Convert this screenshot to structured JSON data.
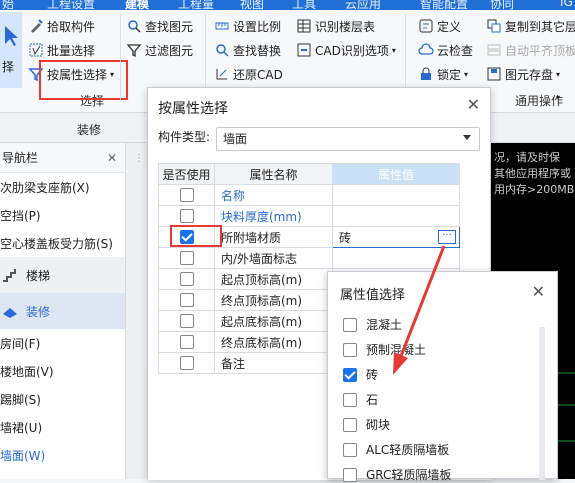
{
  "ribbon": {
    "tabs": [
      "始",
      "工程设置",
      "建模",
      "工程量",
      "视图",
      "工具",
      "云应用",
      "智能配置",
      "协同",
      "IG"
    ],
    "group1": {
      "big_label": "择",
      "pick": "拾取构件",
      "batch": "批量选择",
      "by_attr": "按属性选择",
      "group": "选择"
    },
    "group2": {
      "find": "查找图元",
      "filter": "过滤图元"
    },
    "group3": {
      "scale": "设置比例",
      "find_replace": "查找替换",
      "restore": "还原CAD"
    },
    "group4": {
      "layer": "识别楼层表",
      "cad_opts": "CAD识别选项"
    },
    "group5": {
      "define": "定义",
      "cloud": "云检查",
      "lock": "锁定",
      "copy_floor": "复制到其它层",
      "auto_align": "自动平齐顶板",
      "store": "图元存盘",
      "group": "通用操作"
    },
    "subbar": "装修"
  },
  "nav": {
    "title": "导航栏",
    "items": [
      "次肋梁支座筋(X)",
      "空挡(P)",
      "空心楼盖板受力筋(S)",
      "楼梯",
      "装修",
      "房间(F)",
      "楼地面(V)",
      "踢脚(S)",
      "墙裙(U)",
      "墙面(W)"
    ]
  },
  "dialog1": {
    "title": "按属性选择",
    "type_label": "构件类型:",
    "type_value": "墙面",
    "headers": [
      "是否使用",
      "属性名称",
      "属性值"
    ],
    "rows": [
      {
        "name": "名称",
        "checked": false,
        "blue": true,
        "value": ""
      },
      {
        "name": "块料厚度(mm)",
        "checked": false,
        "blue": true,
        "value": ""
      },
      {
        "name": "所附墙材质",
        "checked": true,
        "blue": false,
        "value": "砖"
      },
      {
        "name": "内/外墙面标志",
        "checked": false,
        "blue": false,
        "value": ""
      },
      {
        "name": "起点顶标高(m)",
        "checked": false,
        "blue": false,
        "value": ""
      },
      {
        "name": "终点顶标高(m)",
        "checked": false,
        "blue": false,
        "value": ""
      },
      {
        "name": "起点底标高(m)",
        "checked": false,
        "blue": false,
        "value": ""
      },
      {
        "name": "终点底标高(m)",
        "checked": false,
        "blue": false,
        "value": ""
      },
      {
        "name": "备注",
        "checked": false,
        "blue": false,
        "value": ""
      }
    ]
  },
  "dialog2": {
    "title": "属性值选择",
    "options": [
      {
        "label": "混凝土",
        "checked": false
      },
      {
        "label": "预制混凝土",
        "checked": false
      },
      {
        "label": "砖",
        "checked": true
      },
      {
        "label": "石",
        "checked": false
      },
      {
        "label": "砌块",
        "checked": false
      },
      {
        "label": "ALC轻质隔墙板",
        "checked": false
      },
      {
        "label": "GRC轻质隔墙板",
        "checked": false
      }
    ]
  },
  "canvas_text": [
    "况，请及时保",
    "其他应用程序或",
    "用内存>200MB"
  ]
}
